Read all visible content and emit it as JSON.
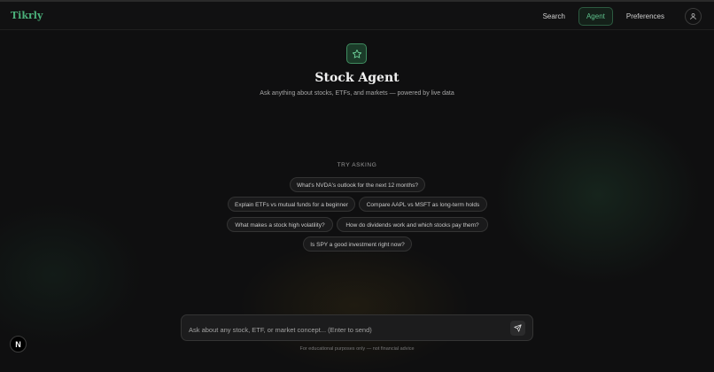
{
  "brand": {
    "name": "Tikrly",
    "color": "#4ab07a"
  },
  "nav": {
    "items": [
      {
        "label": "Search"
      },
      {
        "label": "Agent",
        "active": true
      },
      {
        "label": "Preferences"
      }
    ],
    "avatar_icon": "user-icon"
  },
  "hero": {
    "icon": "star-icon",
    "title": "Stock Agent",
    "subtitle": "Ask anything about stocks, ETFs, and markets — powered by live data"
  },
  "suggestions": {
    "heading": "TRY ASKING",
    "items": [
      "What's NVDA's outlook for the next 12 months?",
      "Explain ETFs vs mutual funds for a beginner",
      "Compare AAPL vs MSFT as long-term holds",
      "What makes a stock high volatility?",
      "How do dividends work and which stocks pay them?",
      "Is SPY a good investment right now?"
    ]
  },
  "composer": {
    "placeholder": "Ask about any stock, ETF, or market concept... (Enter to send)",
    "send_icon": "send-icon"
  },
  "footer": {
    "disclaimer": "For educational purposes only — not financial advice"
  },
  "dev_badge": {
    "label": "N"
  }
}
